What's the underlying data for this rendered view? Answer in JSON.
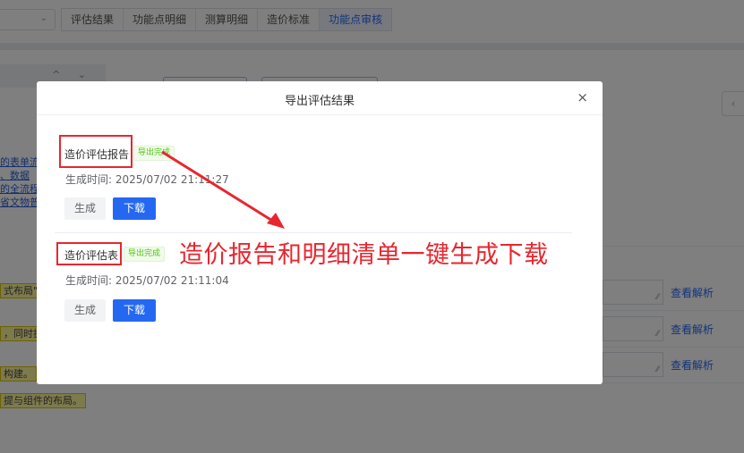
{
  "background": {
    "tabs": [
      "评估结果",
      "功能点明细",
      "测算明细",
      "造价标准",
      "功能点审核"
    ],
    "active_tab_index": 4,
    "left_links": [
      "的表单流",
      "、数据",
      "的全流程",
      "省文物普"
    ],
    "highlights": [
      "式布局\"",
      "，同时提",
      "构建。",
      "提与组件的布局。"
    ],
    "row_link_label": "查看解析",
    "side_tab_glyph": "‹",
    "select_chevron": "⌄",
    "panel_arrows": "^ ⌄",
    "resize_glyph": "⁄⁄"
  },
  "dialog": {
    "title": "导出评估结果",
    "close_glyph": "×",
    "items": [
      {
        "name": "造价评估报告",
        "status": "导出完成",
        "time_label": "生成时间: 2025/07/02 21:11:27",
        "generate_label": "生成",
        "download_label": "下载"
      },
      {
        "name": "造价评估表",
        "status": "导出完成",
        "time_label": "生成时间: 2025/07/02 21:11:04",
        "generate_label": "生成",
        "download_label": "下载"
      }
    ]
  },
  "annotation": {
    "text": "造价报告和明细清单一键生成下载",
    "color": "#e8262e"
  },
  "colors": {
    "primary": "#2468f2",
    "success": "#52c41a",
    "annotation_red": "#e8262e"
  }
}
